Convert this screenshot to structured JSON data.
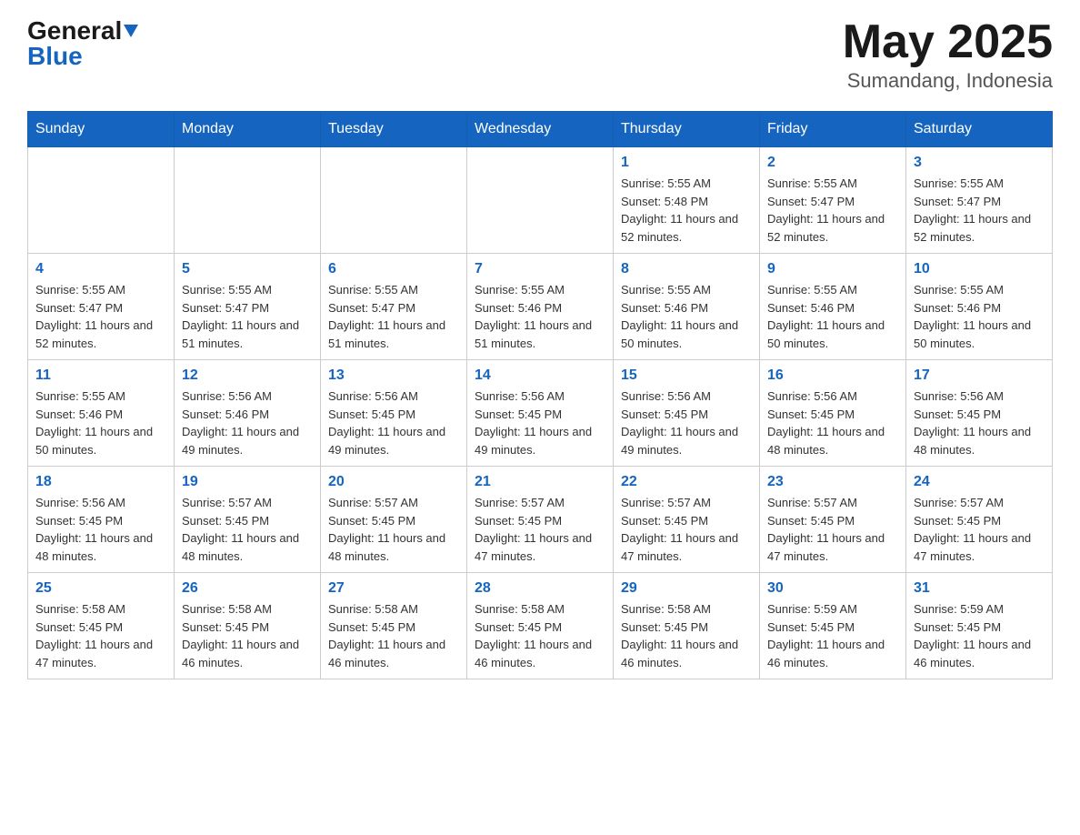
{
  "header": {
    "logo_general": "General",
    "logo_blue": "Blue",
    "month_title": "May 2025",
    "location": "Sumandang, Indonesia"
  },
  "days_of_week": [
    "Sunday",
    "Monday",
    "Tuesday",
    "Wednesday",
    "Thursday",
    "Friday",
    "Saturday"
  ],
  "weeks": [
    [
      {
        "day": "",
        "info": ""
      },
      {
        "day": "",
        "info": ""
      },
      {
        "day": "",
        "info": ""
      },
      {
        "day": "",
        "info": ""
      },
      {
        "day": "1",
        "info": "Sunrise: 5:55 AM\nSunset: 5:48 PM\nDaylight: 11 hours and 52 minutes."
      },
      {
        "day": "2",
        "info": "Sunrise: 5:55 AM\nSunset: 5:47 PM\nDaylight: 11 hours and 52 minutes."
      },
      {
        "day": "3",
        "info": "Sunrise: 5:55 AM\nSunset: 5:47 PM\nDaylight: 11 hours and 52 minutes."
      }
    ],
    [
      {
        "day": "4",
        "info": "Sunrise: 5:55 AM\nSunset: 5:47 PM\nDaylight: 11 hours and 52 minutes."
      },
      {
        "day": "5",
        "info": "Sunrise: 5:55 AM\nSunset: 5:47 PM\nDaylight: 11 hours and 51 minutes."
      },
      {
        "day": "6",
        "info": "Sunrise: 5:55 AM\nSunset: 5:47 PM\nDaylight: 11 hours and 51 minutes."
      },
      {
        "day": "7",
        "info": "Sunrise: 5:55 AM\nSunset: 5:46 PM\nDaylight: 11 hours and 51 minutes."
      },
      {
        "day": "8",
        "info": "Sunrise: 5:55 AM\nSunset: 5:46 PM\nDaylight: 11 hours and 50 minutes."
      },
      {
        "day": "9",
        "info": "Sunrise: 5:55 AM\nSunset: 5:46 PM\nDaylight: 11 hours and 50 minutes."
      },
      {
        "day": "10",
        "info": "Sunrise: 5:55 AM\nSunset: 5:46 PM\nDaylight: 11 hours and 50 minutes."
      }
    ],
    [
      {
        "day": "11",
        "info": "Sunrise: 5:55 AM\nSunset: 5:46 PM\nDaylight: 11 hours and 50 minutes."
      },
      {
        "day": "12",
        "info": "Sunrise: 5:56 AM\nSunset: 5:46 PM\nDaylight: 11 hours and 49 minutes."
      },
      {
        "day": "13",
        "info": "Sunrise: 5:56 AM\nSunset: 5:45 PM\nDaylight: 11 hours and 49 minutes."
      },
      {
        "day": "14",
        "info": "Sunrise: 5:56 AM\nSunset: 5:45 PM\nDaylight: 11 hours and 49 minutes."
      },
      {
        "day": "15",
        "info": "Sunrise: 5:56 AM\nSunset: 5:45 PM\nDaylight: 11 hours and 49 minutes."
      },
      {
        "day": "16",
        "info": "Sunrise: 5:56 AM\nSunset: 5:45 PM\nDaylight: 11 hours and 48 minutes."
      },
      {
        "day": "17",
        "info": "Sunrise: 5:56 AM\nSunset: 5:45 PM\nDaylight: 11 hours and 48 minutes."
      }
    ],
    [
      {
        "day": "18",
        "info": "Sunrise: 5:56 AM\nSunset: 5:45 PM\nDaylight: 11 hours and 48 minutes."
      },
      {
        "day": "19",
        "info": "Sunrise: 5:57 AM\nSunset: 5:45 PM\nDaylight: 11 hours and 48 minutes."
      },
      {
        "day": "20",
        "info": "Sunrise: 5:57 AM\nSunset: 5:45 PM\nDaylight: 11 hours and 48 minutes."
      },
      {
        "day": "21",
        "info": "Sunrise: 5:57 AM\nSunset: 5:45 PM\nDaylight: 11 hours and 47 minutes."
      },
      {
        "day": "22",
        "info": "Sunrise: 5:57 AM\nSunset: 5:45 PM\nDaylight: 11 hours and 47 minutes."
      },
      {
        "day": "23",
        "info": "Sunrise: 5:57 AM\nSunset: 5:45 PM\nDaylight: 11 hours and 47 minutes."
      },
      {
        "day": "24",
        "info": "Sunrise: 5:57 AM\nSunset: 5:45 PM\nDaylight: 11 hours and 47 minutes."
      }
    ],
    [
      {
        "day": "25",
        "info": "Sunrise: 5:58 AM\nSunset: 5:45 PM\nDaylight: 11 hours and 47 minutes."
      },
      {
        "day": "26",
        "info": "Sunrise: 5:58 AM\nSunset: 5:45 PM\nDaylight: 11 hours and 46 minutes."
      },
      {
        "day": "27",
        "info": "Sunrise: 5:58 AM\nSunset: 5:45 PM\nDaylight: 11 hours and 46 minutes."
      },
      {
        "day": "28",
        "info": "Sunrise: 5:58 AM\nSunset: 5:45 PM\nDaylight: 11 hours and 46 minutes."
      },
      {
        "day": "29",
        "info": "Sunrise: 5:58 AM\nSunset: 5:45 PM\nDaylight: 11 hours and 46 minutes."
      },
      {
        "day": "30",
        "info": "Sunrise: 5:59 AM\nSunset: 5:45 PM\nDaylight: 11 hours and 46 minutes."
      },
      {
        "day": "31",
        "info": "Sunrise: 5:59 AM\nSunset: 5:45 PM\nDaylight: 11 hours and 46 minutes."
      }
    ]
  ]
}
